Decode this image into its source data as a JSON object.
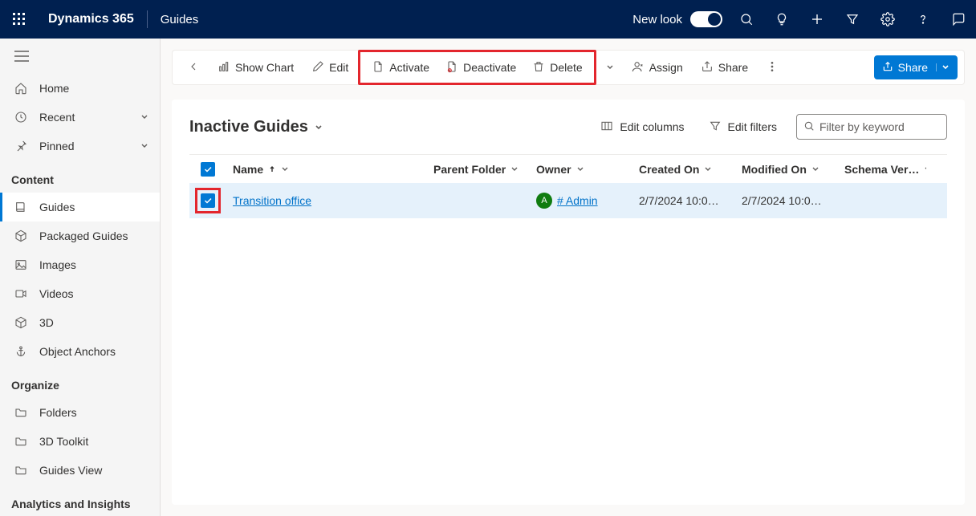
{
  "header": {
    "brand": "Dynamics 365",
    "app": "Guides",
    "new_look": "New look"
  },
  "sidebar": {
    "home": "Home",
    "recent": "Recent",
    "pinned": "Pinned",
    "sections": {
      "content": "Content",
      "organize": "Organize",
      "analytics": "Analytics and Insights"
    },
    "content_items": {
      "guides": "Guides",
      "packaged": "Packaged Guides",
      "images": "Images",
      "videos": "Videos",
      "3d": "3D",
      "anchors": "Object Anchors"
    },
    "organize_items": {
      "folders": "Folders",
      "toolkit": "3D Toolkit",
      "guides_view": "Guides View"
    }
  },
  "commands": {
    "show_chart": "Show Chart",
    "edit": "Edit",
    "activate": "Activate",
    "deactivate": "Deactivate",
    "delete": "Delete",
    "assign": "Assign",
    "share": "Share",
    "share_primary": "Share"
  },
  "view": {
    "title": "Inactive Guides",
    "edit_columns": "Edit columns",
    "edit_filters": "Edit filters",
    "search_placeholder": "Filter by keyword"
  },
  "columns": {
    "name": "Name",
    "parent": "Parent Folder",
    "owner": "Owner",
    "created": "Created On",
    "modified": "Modified On",
    "schema": "Schema Ver…"
  },
  "rows": [
    {
      "name": "Transition office",
      "parent": "",
      "owner_initial": "A",
      "owner": "# Admin",
      "created": "2/7/2024 10:0…",
      "modified": "2/7/2024 10:0…",
      "schema": ""
    }
  ]
}
